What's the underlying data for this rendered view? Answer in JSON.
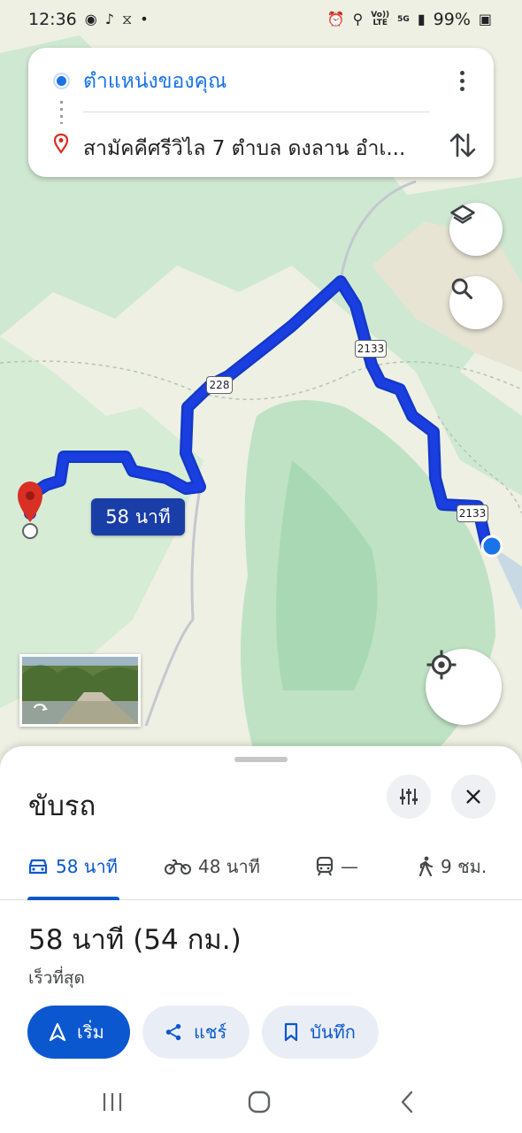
{
  "status_bar": {
    "time": "12:36",
    "net_top": "Vo))",
    "net_bottom": "LTE",
    "signal_label": "5G",
    "battery": "99%"
  },
  "directions": {
    "origin": "ตำแหน่งของคุณ",
    "destination": "สามัคคีศรีวิไล 7 ตำบล ดงลาน อำเ..."
  },
  "map": {
    "route_duration_label": "58 นาที",
    "route_shields": [
      "2133",
      "228",
      "2133"
    ],
    "route_color": "#1a3ee0"
  },
  "sheet": {
    "title": "ขับรถ",
    "modes": [
      {
        "icon": "car-icon",
        "label": "58 นาที",
        "active": true
      },
      {
        "icon": "motorcycle-icon",
        "label": "48 นาที",
        "active": false
      },
      {
        "icon": "transit-icon",
        "label": "—",
        "active": false
      },
      {
        "icon": "walk-icon",
        "label": "9 ชม.",
        "active": false
      }
    ],
    "summary": "58 นาที (54 กม.)",
    "subtitle": "เร็วที่สุด",
    "actions": {
      "start": "เริ่ม",
      "share": "แชร์",
      "save": "บันทึก"
    }
  },
  "colors": {
    "accent": "#0b57d0",
    "origin_blue": "#1a73e8",
    "pin_red": "#d93025"
  }
}
